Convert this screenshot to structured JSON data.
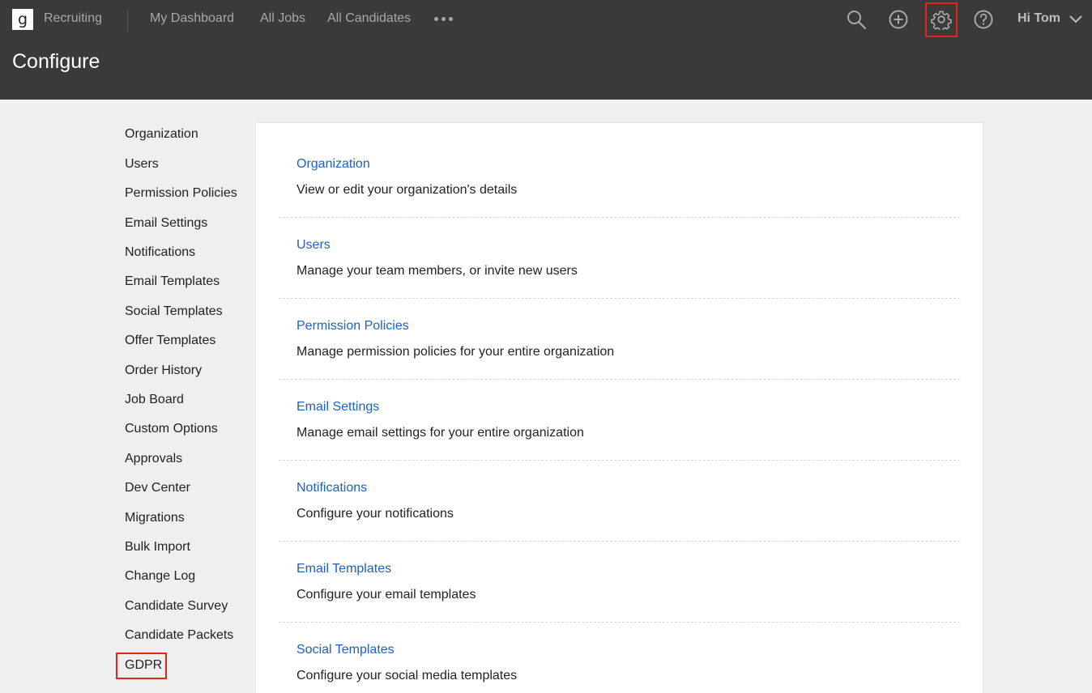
{
  "header": {
    "logo_letter": "g",
    "app_name": "Recruiting",
    "nav": [
      "My Dashboard",
      "All Jobs",
      "All Candidates"
    ],
    "icons": [
      "search-icon",
      "add-icon",
      "settings-icon",
      "help-icon"
    ],
    "user_greeting": "Hi Tom",
    "page_title": "Configure",
    "highlight_color": "#e3261b"
  },
  "sidebar": {
    "items": [
      "Organization",
      "Users",
      "Permission Policies",
      "Email Settings",
      "Notifications",
      "Email Templates",
      "Social Templates",
      "Offer Templates",
      "Order History",
      "Job Board",
      "Custom Options",
      "Approvals",
      "Dev Center",
      "Migrations",
      "Bulk Import",
      "Change Log",
      "Candidate Survey",
      "Candidate Packets",
      "GDPR"
    ]
  },
  "sections": [
    {
      "title": "Organization",
      "desc": "View or edit your organization's details"
    },
    {
      "title": "Users",
      "desc": "Manage your team members, or invite new users"
    },
    {
      "title": "Permission Policies",
      "desc": "Manage permission policies for your entire organization"
    },
    {
      "title": "Email Settings",
      "desc": "Manage email settings for your entire organization"
    },
    {
      "title": "Notifications",
      "desc": "Configure your notifications"
    },
    {
      "title": "Email Templates",
      "desc": "Configure your email templates"
    },
    {
      "title": "Social Templates",
      "desc": "Configure your social media templates"
    }
  ],
  "colors": {
    "link": "#2062b8",
    "header_bg": "#3a3a3a",
    "page_bg": "#efefef"
  }
}
